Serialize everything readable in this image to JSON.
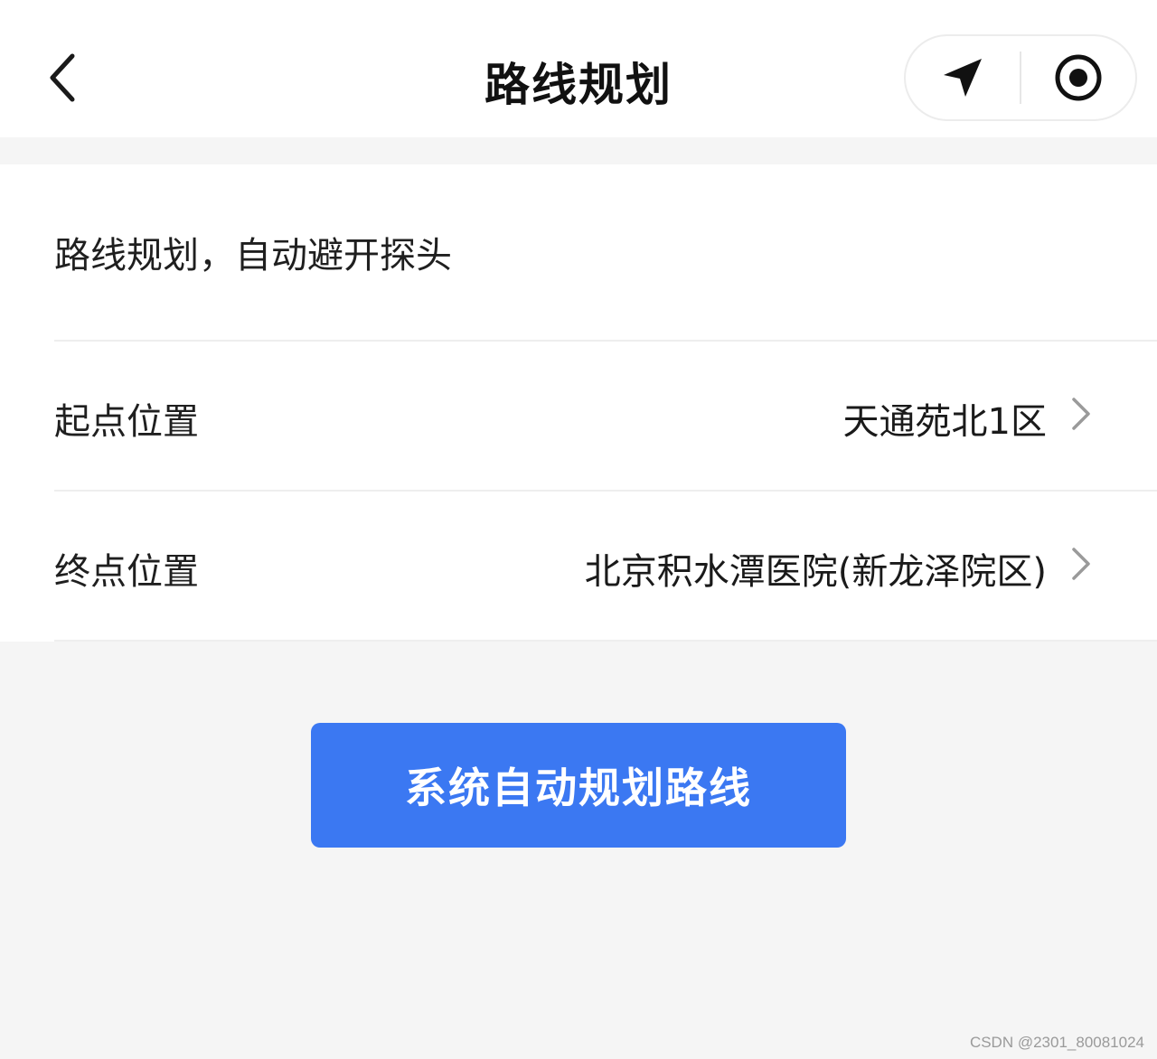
{
  "navbar": {
    "title": "路线规划",
    "back_icon": "chevron-left-icon",
    "capsule": {
      "location_icon": "navigation-arrow-icon",
      "record_icon": "target-circle-icon"
    }
  },
  "form": {
    "description": "路线规划，自动避开探头",
    "start": {
      "label": "起点位置",
      "value": "天通苑北1区",
      "icon": "chevron-right-icon"
    },
    "end": {
      "label": "终点位置",
      "value": "北京积水潭医院(新龙泽院区)",
      "icon": "chevron-right-icon"
    }
  },
  "actions": {
    "auto_plan_label": "系统自动规划路线"
  },
  "watermark": "CSDN @2301_80081024",
  "colors": {
    "primary": "#3b78f2",
    "background": "#f5f5f5",
    "surface": "#ffffff"
  }
}
